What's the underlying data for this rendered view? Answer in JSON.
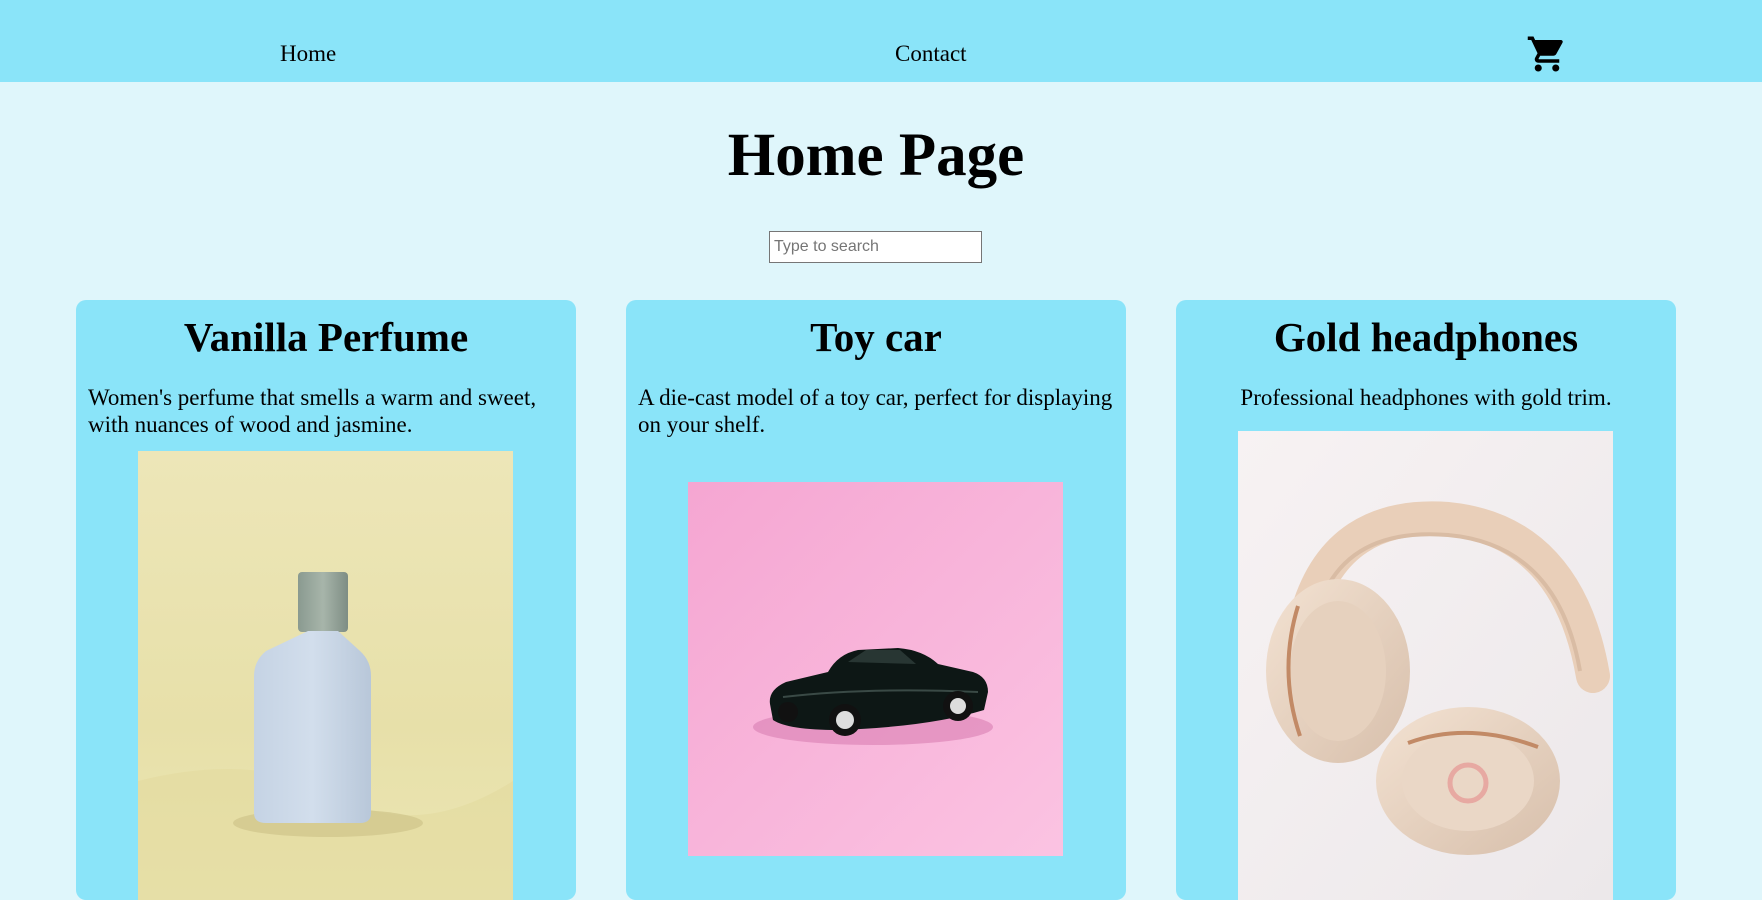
{
  "nav": {
    "home_label": "Home",
    "contact_label": "Contact",
    "cart_icon": "shopping-cart-icon"
  },
  "page": {
    "title": "Home Page"
  },
  "search": {
    "placeholder": "Type to search",
    "value": ""
  },
  "products": [
    {
      "title": "Vanilla Perfume",
      "description": "Women's perfume that smells a warm and sweet, with nuances of wood and jasmine.",
      "image": "perfume-bottle-image"
    },
    {
      "title": "Toy car",
      "description": "A die-cast model of a toy car, perfect for displaying on your shelf.",
      "image": "toy-car-image"
    },
    {
      "title": "Gold headphones",
      "description": "Professional headphones with gold trim.",
      "image": "headphones-image"
    }
  ],
  "colors": {
    "navbar": "#8ae4f9",
    "background": "#dff6fb",
    "card": "#8ae4f9"
  }
}
